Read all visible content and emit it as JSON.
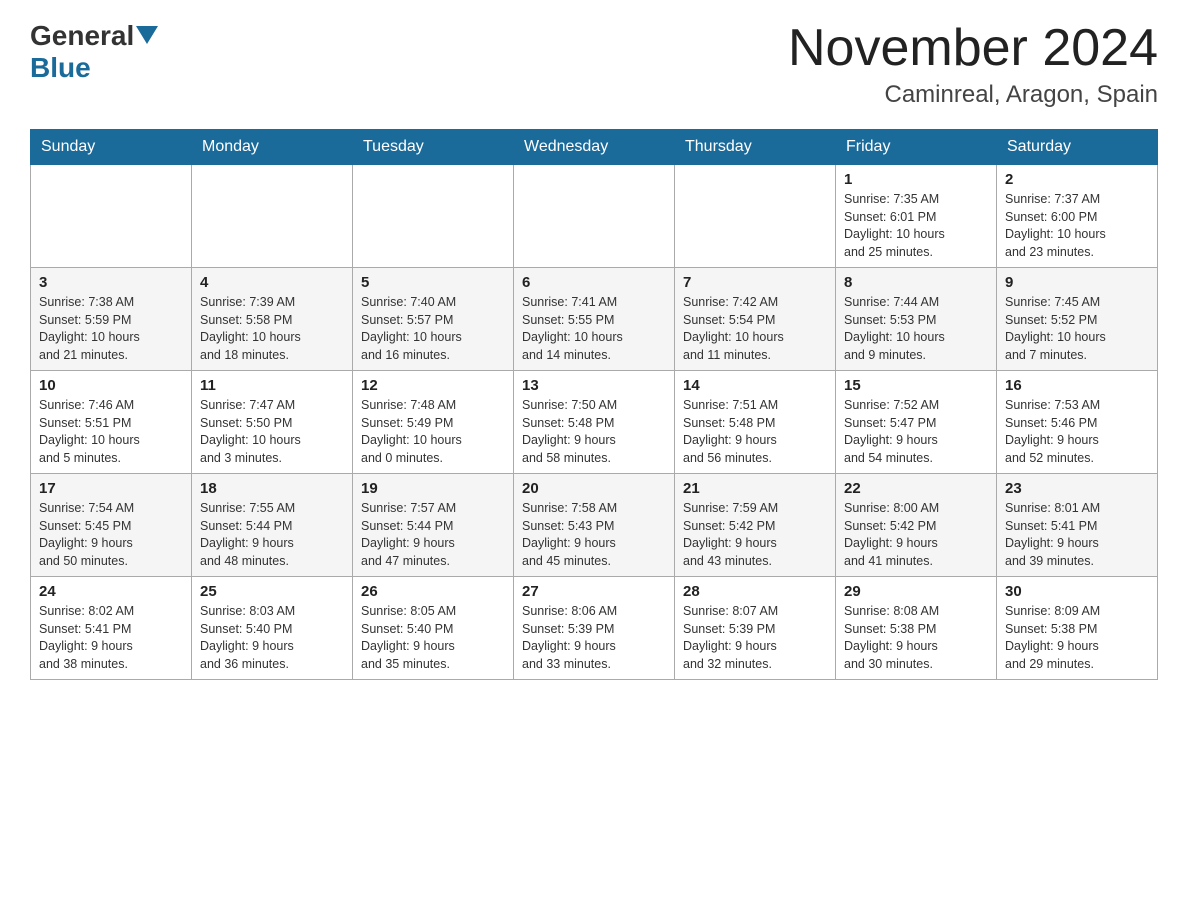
{
  "header": {
    "logo_general": "General",
    "logo_blue": "Blue",
    "month_title": "November 2024",
    "location": "Caminreal, Aragon, Spain"
  },
  "weekdays": [
    "Sunday",
    "Monday",
    "Tuesday",
    "Wednesday",
    "Thursday",
    "Friday",
    "Saturday"
  ],
  "weeks": [
    [
      {
        "day": "",
        "info": ""
      },
      {
        "day": "",
        "info": ""
      },
      {
        "day": "",
        "info": ""
      },
      {
        "day": "",
        "info": ""
      },
      {
        "day": "",
        "info": ""
      },
      {
        "day": "1",
        "info": "Sunrise: 7:35 AM\nSunset: 6:01 PM\nDaylight: 10 hours\nand 25 minutes."
      },
      {
        "day": "2",
        "info": "Sunrise: 7:37 AM\nSunset: 6:00 PM\nDaylight: 10 hours\nand 23 minutes."
      }
    ],
    [
      {
        "day": "3",
        "info": "Sunrise: 7:38 AM\nSunset: 5:59 PM\nDaylight: 10 hours\nand 21 minutes."
      },
      {
        "day": "4",
        "info": "Sunrise: 7:39 AM\nSunset: 5:58 PM\nDaylight: 10 hours\nand 18 minutes."
      },
      {
        "day": "5",
        "info": "Sunrise: 7:40 AM\nSunset: 5:57 PM\nDaylight: 10 hours\nand 16 minutes."
      },
      {
        "day": "6",
        "info": "Sunrise: 7:41 AM\nSunset: 5:55 PM\nDaylight: 10 hours\nand 14 minutes."
      },
      {
        "day": "7",
        "info": "Sunrise: 7:42 AM\nSunset: 5:54 PM\nDaylight: 10 hours\nand 11 minutes."
      },
      {
        "day": "8",
        "info": "Sunrise: 7:44 AM\nSunset: 5:53 PM\nDaylight: 10 hours\nand 9 minutes."
      },
      {
        "day": "9",
        "info": "Sunrise: 7:45 AM\nSunset: 5:52 PM\nDaylight: 10 hours\nand 7 minutes."
      }
    ],
    [
      {
        "day": "10",
        "info": "Sunrise: 7:46 AM\nSunset: 5:51 PM\nDaylight: 10 hours\nand 5 minutes."
      },
      {
        "day": "11",
        "info": "Sunrise: 7:47 AM\nSunset: 5:50 PM\nDaylight: 10 hours\nand 3 minutes."
      },
      {
        "day": "12",
        "info": "Sunrise: 7:48 AM\nSunset: 5:49 PM\nDaylight: 10 hours\nand 0 minutes."
      },
      {
        "day": "13",
        "info": "Sunrise: 7:50 AM\nSunset: 5:48 PM\nDaylight: 9 hours\nand 58 minutes."
      },
      {
        "day": "14",
        "info": "Sunrise: 7:51 AM\nSunset: 5:48 PM\nDaylight: 9 hours\nand 56 minutes."
      },
      {
        "day": "15",
        "info": "Sunrise: 7:52 AM\nSunset: 5:47 PM\nDaylight: 9 hours\nand 54 minutes."
      },
      {
        "day": "16",
        "info": "Sunrise: 7:53 AM\nSunset: 5:46 PM\nDaylight: 9 hours\nand 52 minutes."
      }
    ],
    [
      {
        "day": "17",
        "info": "Sunrise: 7:54 AM\nSunset: 5:45 PM\nDaylight: 9 hours\nand 50 minutes."
      },
      {
        "day": "18",
        "info": "Sunrise: 7:55 AM\nSunset: 5:44 PM\nDaylight: 9 hours\nand 48 minutes."
      },
      {
        "day": "19",
        "info": "Sunrise: 7:57 AM\nSunset: 5:44 PM\nDaylight: 9 hours\nand 47 minutes."
      },
      {
        "day": "20",
        "info": "Sunrise: 7:58 AM\nSunset: 5:43 PM\nDaylight: 9 hours\nand 45 minutes."
      },
      {
        "day": "21",
        "info": "Sunrise: 7:59 AM\nSunset: 5:42 PM\nDaylight: 9 hours\nand 43 minutes."
      },
      {
        "day": "22",
        "info": "Sunrise: 8:00 AM\nSunset: 5:42 PM\nDaylight: 9 hours\nand 41 minutes."
      },
      {
        "day": "23",
        "info": "Sunrise: 8:01 AM\nSunset: 5:41 PM\nDaylight: 9 hours\nand 39 minutes."
      }
    ],
    [
      {
        "day": "24",
        "info": "Sunrise: 8:02 AM\nSunset: 5:41 PM\nDaylight: 9 hours\nand 38 minutes."
      },
      {
        "day": "25",
        "info": "Sunrise: 8:03 AM\nSunset: 5:40 PM\nDaylight: 9 hours\nand 36 minutes."
      },
      {
        "day": "26",
        "info": "Sunrise: 8:05 AM\nSunset: 5:40 PM\nDaylight: 9 hours\nand 35 minutes."
      },
      {
        "day": "27",
        "info": "Sunrise: 8:06 AM\nSunset: 5:39 PM\nDaylight: 9 hours\nand 33 minutes."
      },
      {
        "day": "28",
        "info": "Sunrise: 8:07 AM\nSunset: 5:39 PM\nDaylight: 9 hours\nand 32 minutes."
      },
      {
        "day": "29",
        "info": "Sunrise: 8:08 AM\nSunset: 5:38 PM\nDaylight: 9 hours\nand 30 minutes."
      },
      {
        "day": "30",
        "info": "Sunrise: 8:09 AM\nSunset: 5:38 PM\nDaylight: 9 hours\nand 29 minutes."
      }
    ]
  ]
}
